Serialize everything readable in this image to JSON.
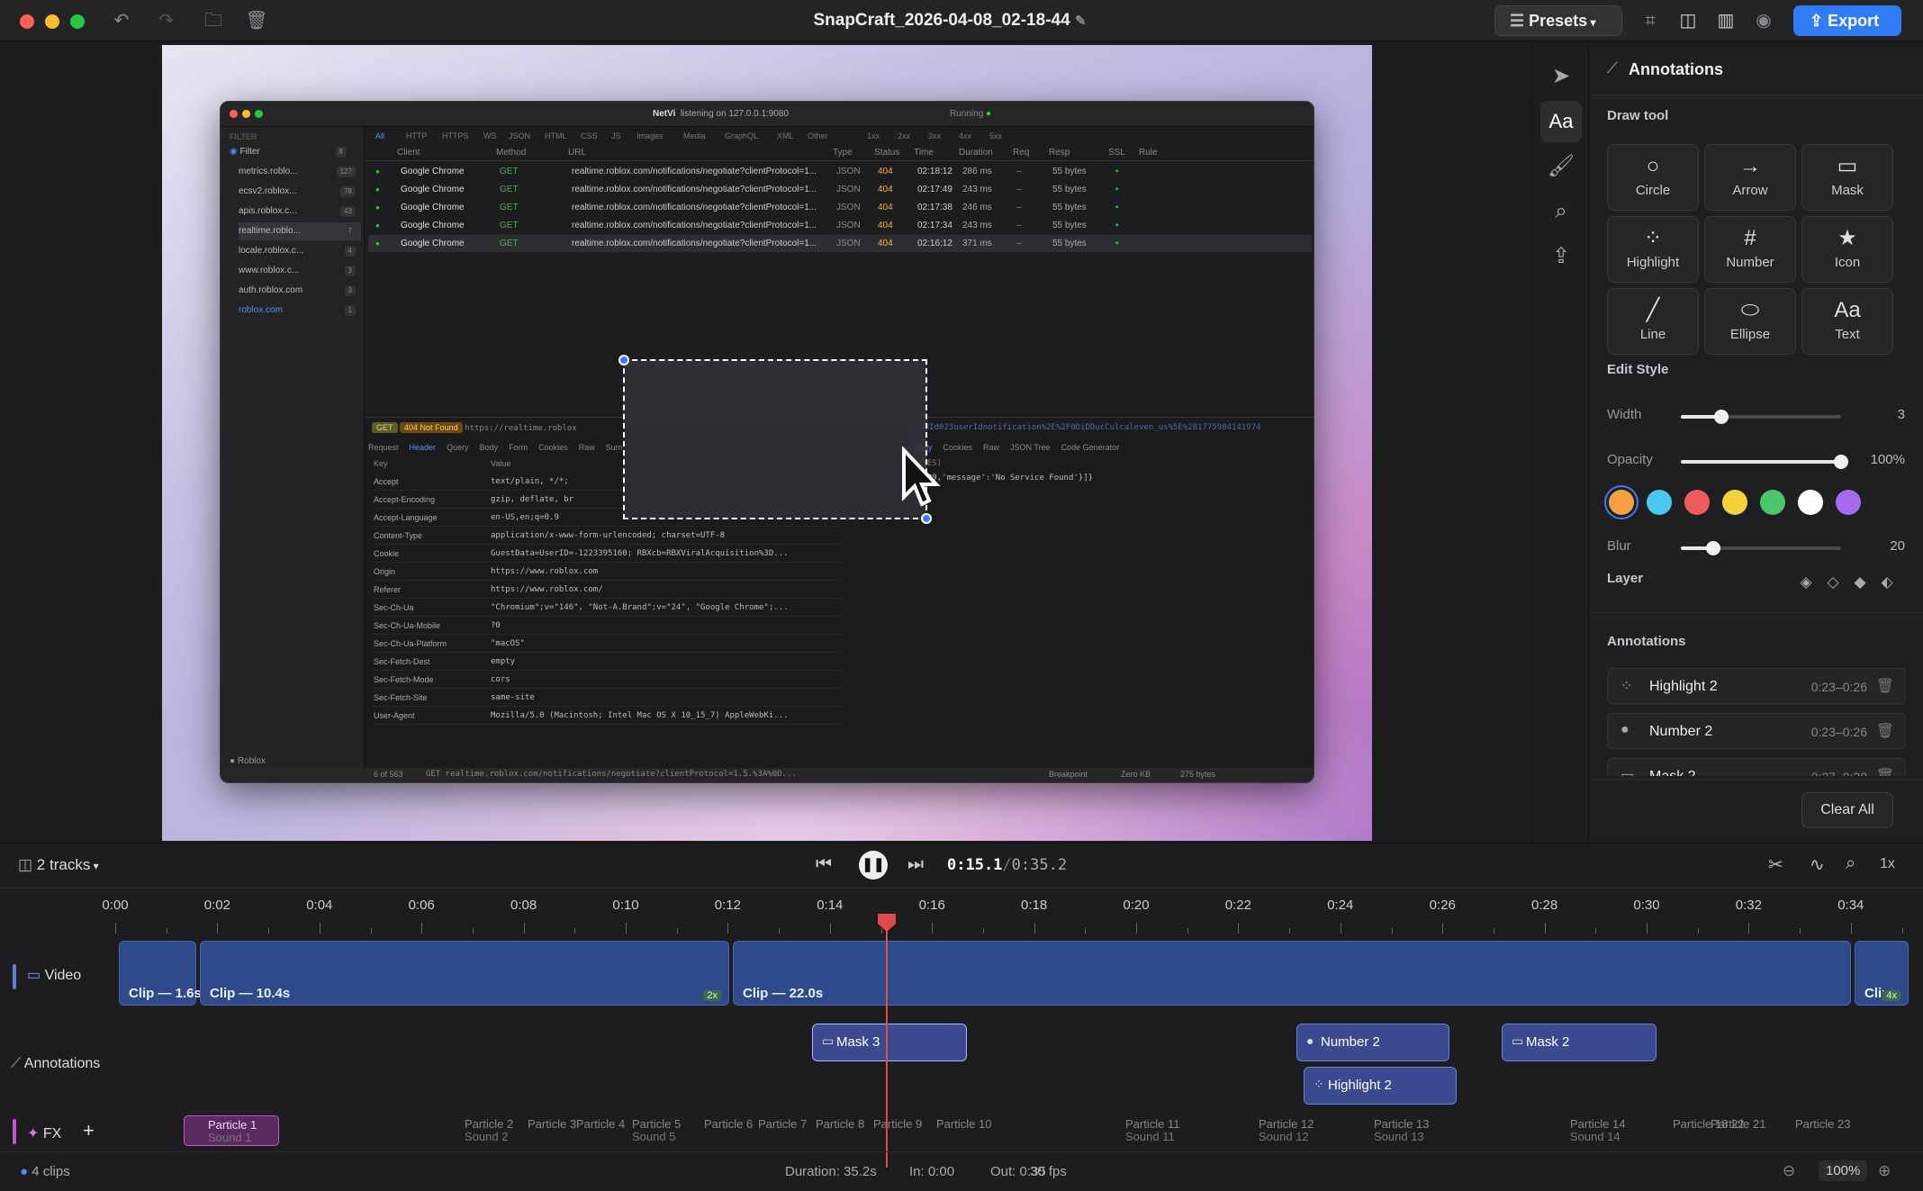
{
  "window": {
    "title": "SnapCraft_2026-04-08_02-18-44",
    "presets_label": "Presets",
    "export_label": "Export"
  },
  "inner_screenshot": {
    "app_name": "NetVi",
    "listening": "listening on 127.0.0.1:9080",
    "status": "Running",
    "filter_label": "Filter",
    "filter_heading": "FILTER",
    "filter_count": "8",
    "sidebar": [
      {
        "label": "metrics.roblo...",
        "count": "127"
      },
      {
        "label": "ecsv2.roblox...",
        "count": "78"
      },
      {
        "label": "apis.roblox.c...",
        "count": "43"
      },
      {
        "label": "realtime.roblo...",
        "count": "7"
      },
      {
        "label": "locale.roblox.c...",
        "count": "4"
      },
      {
        "label": "www.roblox.c...",
        "count": "3"
      },
      {
        "label": "auth.roblox.com",
        "count": "3"
      },
      {
        "label": "roblox.com",
        "count": "1"
      }
    ],
    "footer_app": "Roblox",
    "tabs": [
      "All",
      "HTTP",
      "HTTPS",
      "WS",
      "JSON",
      "HTML",
      "CSS",
      "JS",
      "Images",
      "Media",
      "GraphQL",
      "XML",
      "Other",
      "1xx",
      "2xx",
      "3xx",
      "4xx",
      "5xx"
    ],
    "columns": [
      "Client",
      "Method",
      "URL",
      "Type",
      "Status",
      "Time",
      "Duration",
      "Req",
      "Resp",
      "SSL",
      "Rule"
    ],
    "rows": [
      {
        "client": "Google Chrome",
        "method": "GET",
        "url": "realtime.roblox.com/notifications/negotiate?clientProtocol=1...",
        "type": "JSON",
        "status": "404",
        "time": "02:18:12",
        "duration": "286 ms",
        "req": "–",
        "resp": "55 bytes"
      },
      {
        "client": "Google Chrome",
        "method": "GET",
        "url": "realtime.roblox.com/notifications/negotiate?clientProtocol=1...",
        "type": "JSON",
        "status": "404",
        "time": "02:17:49",
        "duration": "243 ms",
        "req": "–",
        "resp": "55 bytes"
      },
      {
        "client": "Google Chrome",
        "method": "GET",
        "url": "realtime.roblox.com/notifications/negotiate?clientProtocol=1...",
        "type": "JSON",
        "status": "404",
        "time": "02:17:38",
        "duration": "246 ms",
        "req": "–",
        "resp": "55 bytes"
      },
      {
        "client": "Google Chrome",
        "method": "GET",
        "url": "realtime.roblox.com/notifications/negotiate?clientProtocol=1...",
        "type": "JSON",
        "status": "404",
        "time": "02:17:34",
        "duration": "243 ms",
        "req": "–",
        "resp": "55 bytes"
      },
      {
        "client": "Google Chrome",
        "method": "GET",
        "url": "realtime.roblox.com/notifications/negotiate?clientProtocol=1...",
        "type": "JSON",
        "status": "404",
        "time": "02:16:12",
        "duration": "371 ms",
        "req": "–",
        "resp": "55 bytes"
      }
    ],
    "detail_method": "GET",
    "detail_status": "404 Not Found",
    "detail_url": "https://realtime.roblox",
    "detail_url_tail": "...3dId023userIdnotification%2E%2F0DiDDucCulcaleven_us%5E%2B1775984141974",
    "request_tabs": [
      "Request",
      "Header",
      "Query",
      "Body",
      "Form",
      "Cookies",
      "Raw",
      "Sum"
    ],
    "response_tabs": [
      "Body",
      "Cookies",
      "Raw",
      "JSON Tree",
      "Code Generator"
    ],
    "response_body": "9009,'message':'No Service Found'}]}",
    "response_header": "YTES)",
    "kv_head": [
      "Key",
      "Value"
    ],
    "headers": [
      {
        "k": "Accept",
        "v": "text/plain, */*;"
      },
      {
        "k": "Accept-Encoding",
        "v": "gzip, deflate, br"
      },
      {
        "k": "Accept-Language",
        "v": "en-US,en;q=0.9"
      },
      {
        "k": "Content-Type",
        "v": "application/x-www-form-urlencoded; charset=UTF-8"
      },
      {
        "k": "Cookie",
        "v": "GuestData=UserID=-1223395160; RBXcb=RBXViralAcquisition%3D..."
      },
      {
        "k": "Origin",
        "v": "https://www.roblox.com"
      },
      {
        "k": "Referer",
        "v": "https://www.roblox.com/"
      },
      {
        "k": "Sec-Ch-Ua",
        "v": "\"Chromium\";v=\"146\", \"Not-A.Brand\";v=\"24\", \"Google Chrome\";..."
      },
      {
        "k": "Sec-Ch-Ua-Mobile",
        "v": "?0"
      },
      {
        "k": "Sec-Ch-Ua-Platform",
        "v": "\"macOS\""
      },
      {
        "k": "Sec-Fetch-Dest",
        "v": "empty"
      },
      {
        "k": "Sec-Fetch-Mode",
        "v": "cors"
      },
      {
        "k": "Sec-Fetch-Site",
        "v": "same-site"
      },
      {
        "k": "User-Agent",
        "v": "Mozilla/5.0 (Macintosh; Intel Mac OS X 10_15_7) AppleWebKi..."
      }
    ],
    "status_text": "6 of 563",
    "status_url": "GET realtime.roblox.com/notifications/negotiate?clientProtocol=1.5.%3A%0D...",
    "breakpoint": "Breakpoint",
    "zero_kb": "Zero KB",
    "bytes": "275 bytes"
  },
  "panel": {
    "title": "Annotations",
    "draw_tool_label": "Draw tool",
    "tools": [
      {
        "label": "Circle",
        "glyph": "○",
        "icon": "circle-tool-icon"
      },
      {
        "label": "Arrow",
        "glyph": "→",
        "icon": "arrow-tool-icon"
      },
      {
        "label": "Mask",
        "glyph": "▭",
        "icon": "mask-tool-icon"
      },
      {
        "label": "Highlight",
        "glyph": "⁘",
        "icon": "highlight-tool-icon"
      },
      {
        "label": "Number",
        "glyph": "#",
        "icon": "number-tool-icon"
      },
      {
        "label": "Icon",
        "glyph": "★",
        "icon": "icon-tool-icon"
      },
      {
        "label": "Line",
        "glyph": "╱",
        "icon": "line-tool-icon"
      },
      {
        "label": "Ellipse",
        "glyph": "⬭",
        "icon": "ellipse-tool-icon"
      },
      {
        "label": "Text",
        "glyph": "Aa",
        "icon": "text-tool-icon"
      }
    ],
    "edit_style_label": "Edit Style",
    "width_label": "Width",
    "width_value": "3",
    "width_fraction": 0.25,
    "opacity_label": "Opacity",
    "opacity_value": "100%",
    "opacity_fraction": 1.0,
    "blur_label": "Blur",
    "blur_value": "20",
    "blur_fraction": 0.2,
    "colors": [
      "#f5a043",
      "#4cc8f0",
      "#ef5b5b",
      "#f3d23c",
      "#4bc76b",
      "#ffffff",
      "#a46bf0"
    ],
    "selected_color": "#f5a043",
    "layer_label": "Layer",
    "annotations_label": "Annotations",
    "annotations": [
      {
        "name": "Highlight 2",
        "time": "0:23–0:26",
        "icon": "highlight-icon",
        "glyph": "⁘"
      },
      {
        "name": "Number 2",
        "time": "0:23–0:26",
        "icon": "number-icon",
        "glyph": "●"
      },
      {
        "name": "Mask 2",
        "time": "0:27–0:30",
        "icon": "mask-icon",
        "glyph": "▭"
      }
    ],
    "clear_all_label": "Clear All"
  },
  "timeline": {
    "tracks_label": "2 tracks",
    "current_time": "0:15.1",
    "total_time": "0:35.2",
    "speed": "1x",
    "ticks": [
      "0:00",
      "0:02",
      "0:04",
      "0:06",
      "0:08",
      "0:10",
      "0:12",
      "0:14",
      "0:16",
      "0:18",
      "0:20",
      "0:22",
      "0:24",
      "0:26",
      "0:28",
      "0:30",
      "0:32",
      "0:34"
    ],
    "video_track_label": "Video",
    "annotations_track_label": "Annotations",
    "fx_track_label": "FX",
    "video_clips": [
      {
        "name": "Clip — 1.6s"
      },
      {
        "name": "Clip — 10.4s",
        "badge": "2x"
      },
      {
        "name": "Clip — 22.0s"
      },
      {
        "name": "Clip",
        "badge": "4x"
      }
    ],
    "annotation_clips": [
      {
        "name": "Mask 3",
        "glyph": "▭"
      },
      {
        "name": "Number 2",
        "glyph": "●"
      },
      {
        "name": "Mask 2",
        "glyph": "▭"
      },
      {
        "name": "Highlight 2",
        "glyph": "⁘"
      }
    ],
    "fx_clips": [
      {
        "name": "Particle 1",
        "sound": "Sound 1"
      },
      {
        "name": "Particle 2",
        "sound": "Sound 2"
      },
      {
        "name": "Particle 3",
        "sound": ""
      },
      {
        "name": "Particle 4",
        "sound": ""
      },
      {
        "name": "Particle 5",
        "sound": "Sound 5"
      },
      {
        "name": "Particle 6",
        "sound": ""
      },
      {
        "name": "Particle 7",
        "sound": ""
      },
      {
        "name": "Particle 8",
        "sound": ""
      },
      {
        "name": "Particle 9",
        "sound": ""
      },
      {
        "name": "Particle 10",
        "sound": ""
      },
      {
        "name": "Particle 11",
        "sound": "Sound 11"
      },
      {
        "name": "Particle 12",
        "sound": "Sound 12"
      },
      {
        "name": "Particle 13",
        "sound": "Sound 13"
      },
      {
        "name": "Particle 14",
        "sound": "Sound 14"
      },
      {
        "name": "Particle 18 22",
        "sound": ""
      },
      {
        "name": "Particle 21",
        "sound": ""
      },
      {
        "name": "Particle 23",
        "sound": ""
      }
    ]
  },
  "status_bar": {
    "clips": "4 clips",
    "duration": "Duration: 35.2s",
    "in": "In: 0:00",
    "out": "Out: 0:35",
    "fps": "30 fps",
    "zoom": "100%"
  }
}
